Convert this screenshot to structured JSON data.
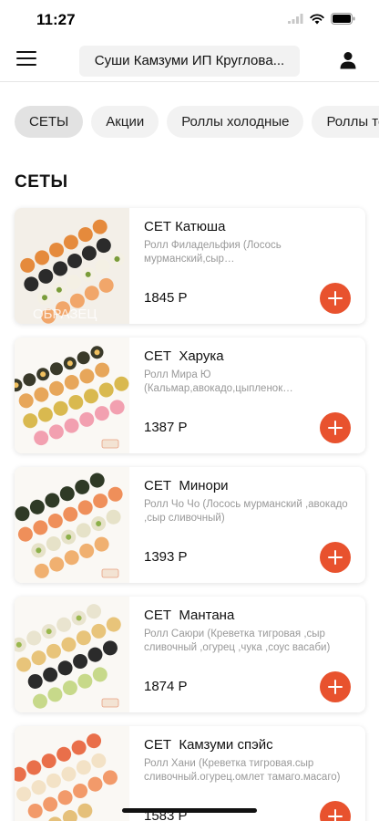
{
  "status_bar": {
    "time": "11:27"
  },
  "header": {
    "title": "Суши Камзуми ИП Кругловa..."
  },
  "categories": [
    "СЕТЫ",
    "Акции",
    "Роллы холодные",
    "Роллы теплые"
  ],
  "section": {
    "title": "СЕТЫ"
  },
  "products": [
    {
      "name": "СЕТ Катюша",
      "description": " Ролл Филадельфия (Лосось мурманский,сыр сливочный,авокадо,огурец)",
      "price": "1845 Р",
      "watermark": "ОБРАЗЕЦ"
    },
    {
      "name": "СЕТ  Харука",
      "description": "Ролл Мира Ю (Кальмар,авокадо,цыпленок отварной,соус)",
      "price": "1387 Р"
    },
    {
      "name": "СЕТ  Минори",
      "description": "Ролл Чо Чо (Лосось мурманский ,авокадо ,сыр сливочный)",
      "price": "1393 Р"
    },
    {
      "name": "СЕТ  Мантана",
      "description": "Ролл Саюри (Креветка тигровая ,сыр сливочный ,огурец ,чука ,соус васаби)",
      "price": "1874 Р"
    },
    {
      "name": "СЕТ  Камзуми спэйс",
      "description": "Ролл Хани (Креветка тигровая.сыр сливочный.огурец.омлет тамаго.масаго)",
      "price": "1583 Р"
    }
  ],
  "colors": {
    "accent": "#e8522e",
    "tab_bg": "#f2f2f2",
    "muted_text": "#999999"
  }
}
